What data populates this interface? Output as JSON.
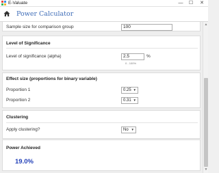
{
  "window": {
    "title": "E-Valuate",
    "minimize_glyph": "—",
    "maximize_glyph": "☐",
    "close_glyph": "✕"
  },
  "header": {
    "app_name": "Power Calculator",
    "home_icon": "home-icon"
  },
  "sample_size": {
    "label": "Sample size for comparison group",
    "value": "100"
  },
  "significance": {
    "title": "Level of Significance",
    "label": "Level of significance (alpha)",
    "value": "2.5",
    "unit": "%",
    "hint": "0 - 100%"
  },
  "effect_size": {
    "title": "Effect size (proportions for binary variable)",
    "proportion1_label": "Proportion 1",
    "proportion1_value": "0.25",
    "proportion2_label": "Proportion 2",
    "proportion2_value": "0.31"
  },
  "clustering": {
    "title": "Clustering",
    "label": "Apply clustering?",
    "value": "No"
  },
  "power": {
    "title": "Power Achieved",
    "value": "19.0%"
  },
  "colors": {
    "accent": "#3d6cb7",
    "result": "#2240b8",
    "background": "#eeeeee"
  }
}
